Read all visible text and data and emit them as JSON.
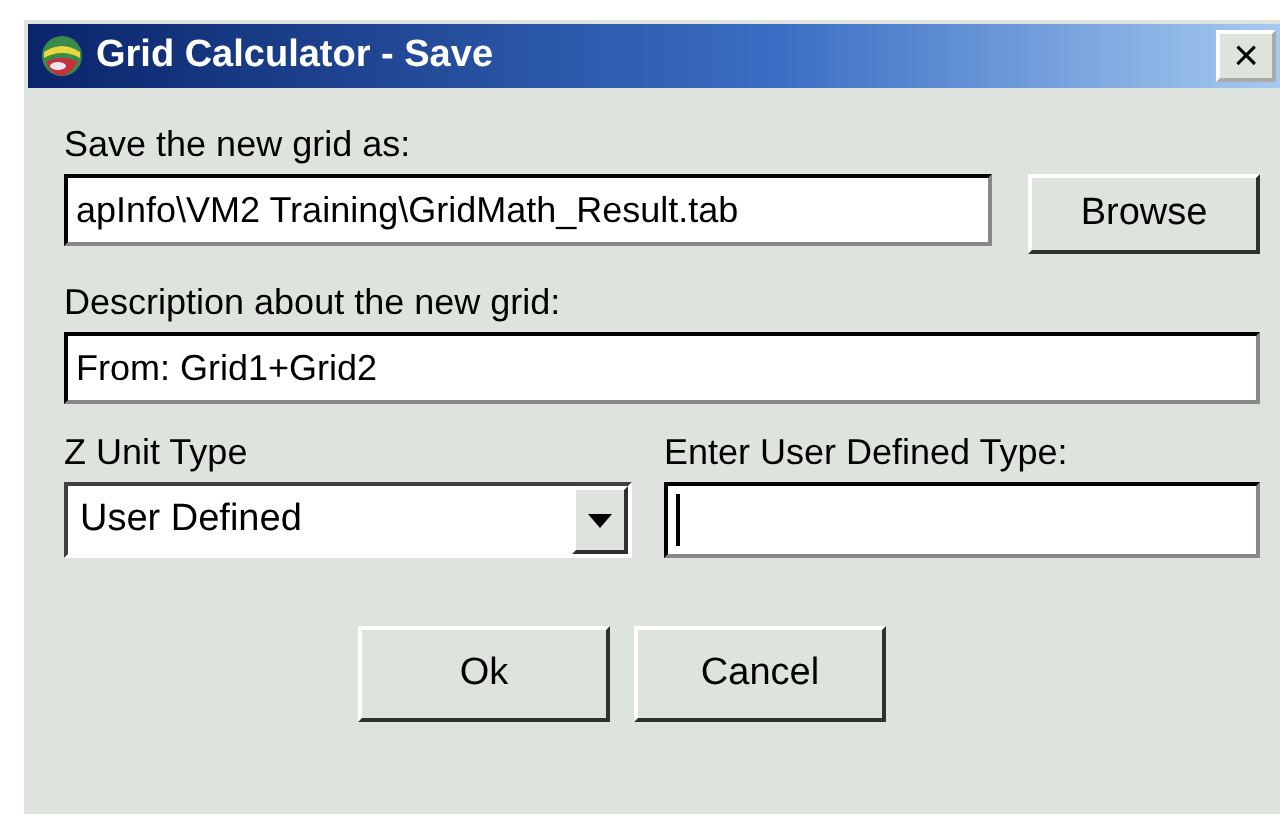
{
  "window": {
    "title": "Grid Calculator - Save",
    "close": "×"
  },
  "save_as": {
    "label": "Save the new grid as:",
    "value": "apInfo\\VM2 Training\\GridMath_Result.tab",
    "button": "Browse"
  },
  "description": {
    "label": "Description about the new grid:",
    "value": "From: Grid1+Grid2"
  },
  "z_unit": {
    "label": "Z Unit Type",
    "value": "User Defined"
  },
  "user_type": {
    "label": "Enter User Defined Type:",
    "focused": true
  },
  "buttons": [
    "Ok",
    "Cancel"
  ]
}
